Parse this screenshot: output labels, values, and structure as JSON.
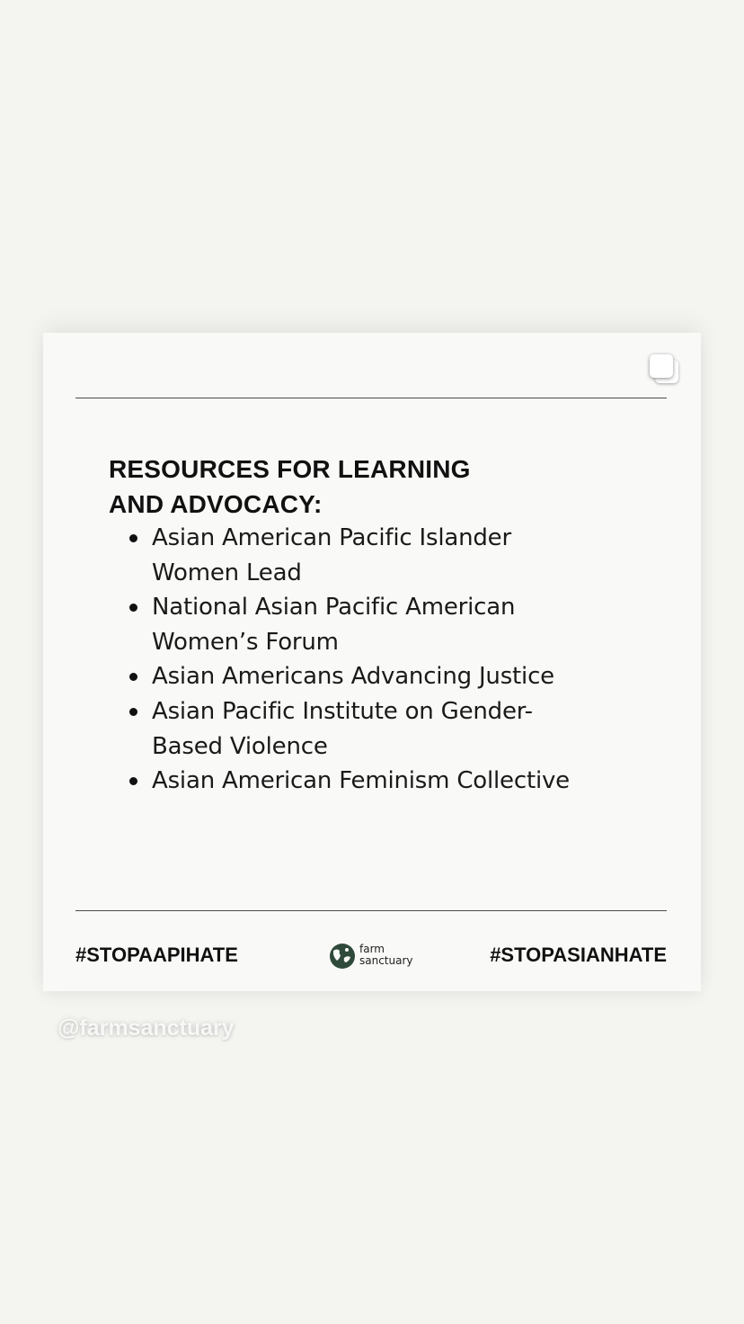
{
  "card": {
    "heading": {
      "line1": "RESOURCES FOR LEARNING",
      "line2": "AND ADVOCACY:"
    },
    "resources": [
      {
        "line1": "Asian American Pacific Islander",
        "line2": "Women Lead"
      },
      {
        "line1": "National Asian Pacific American",
        "line2": "Women’s Forum"
      },
      {
        "line1": "Asian Americans Advancing Justice",
        "line2": ""
      },
      {
        "line1": "Asian Pacific Institute on Gender-",
        "line2": "Based Violence"
      },
      {
        "line1": "Asian American Feminism Collective",
        "line2": ""
      }
    ],
    "footer": {
      "left_hashtag": "#STOPAAPIHATE",
      "right_hashtag": "#STOPASIANHATE",
      "logo_line1": "farm",
      "logo_line2": "sanctuary"
    }
  },
  "mention": "@farmsanctuary",
  "icons": {
    "top_right": "copy-icon",
    "logo_mark": "farm-sanctuary-logo-icon"
  },
  "colors": {
    "background": "#f4f4f0",
    "card": "#f9f9f7",
    "text": "#111111",
    "logo_green": "#2f4a3a"
  }
}
